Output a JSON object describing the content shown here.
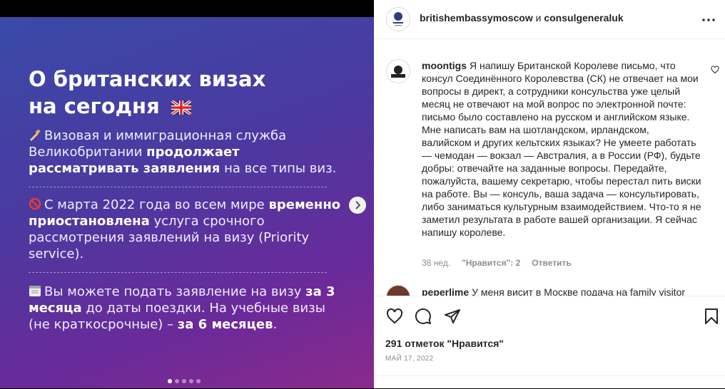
{
  "slide": {
    "title_line1": "О британских визах",
    "title_line2": "на сегодня",
    "p1_a": "Визовая и иммиграционная служба Великобритании ",
    "p1_b": "продолжает рассматривать заявления",
    "p1_c": " на все типы виз.",
    "p2_a": "С марта 2022 года во всем мире ",
    "p2_b": "временно приостановлена",
    "p2_c": " услуга срочного рассмотрения заявлений на визу (Priority service).",
    "p3_a": "Вы можете подать заявление на визу ",
    "p3_b": "за 3 месяца",
    "p3_c": " до даты поездки. На учебные визы (не краткосрочные) – ",
    "p3_d": "за 6 месяцев",
    "p3_e": ".",
    "dot_count": 5,
    "active_dot": 1
  },
  "post": {
    "author": "britishembassymoscow",
    "conjunction": "и",
    "coauthor": "consulgeneraluk"
  },
  "comment1": {
    "user": "moontigs",
    "text": "Я напишу Британской Королеве письмо, что консул Соединённого Королевства (СК) не отвечает на мои вопросы в директ, а сотрудники консульства уже целый месяц не отвечают на мой вопрос по электронной почте: письмо было составлено на русском и английском языке. Мне написать вам на шотландском, ирландском, валийском и других кельтских языках? Не умеете работать — чемодан — вокзал — Австралия, а в России (РФ), будьте добры: отвечайте на заданные вопросы. Передайте, пожалуйста, вашему секретарю, чтобы перестал пить виски на работе. Вы — консуль, ваша задача — консультировать, либо заниматься культурным взаимодействием. Что-то я не заметил результата в работе вашей организации. Я сейчас напишу королеве.",
    "time": "38 нед.",
    "likes": "\"Нравится\": 2",
    "reply": "Ответить"
  },
  "comment2": {
    "user": "peperlime",
    "text": "У меня висит в Москве подача на family visitor"
  },
  "likes_text": "291 отметок \"Нравится\"",
  "date": "МАЙ 17, 2022",
  "icons": {
    "like": "heart-icon",
    "comment": "comment-icon",
    "share": "share-icon",
    "save": "bookmark-icon",
    "more": "more-icon"
  },
  "colors": {
    "text": "#262626",
    "secondary": "#8e8e8e",
    "border": "#efefef"
  }
}
